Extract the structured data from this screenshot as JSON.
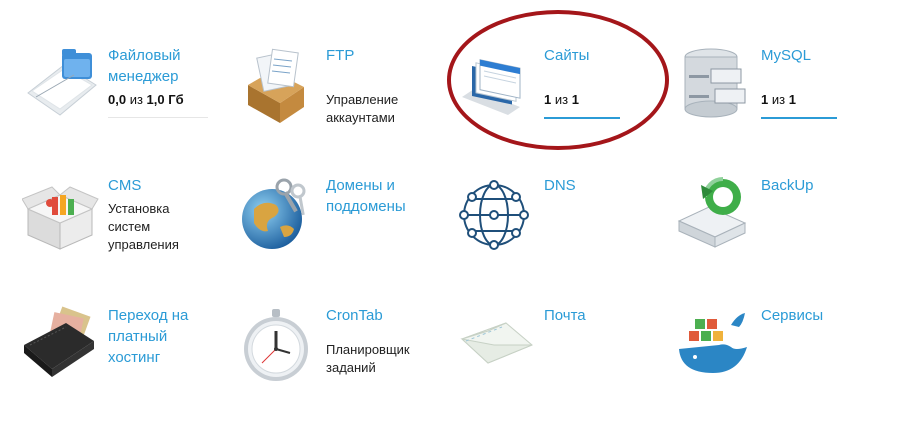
{
  "tiles": [
    {
      "id": "file-manager",
      "title": "Файловый\nменеджер",
      "usage_used": "0,0",
      "usage_sep": " из ",
      "usage_total": "1,0 Гб",
      "usage_fraction": 0.0,
      "icon": "folder-icon"
    },
    {
      "id": "ftp",
      "title": "FTP",
      "desc": "Управление\nаккаунтами",
      "icon": "ftp-box-icon"
    },
    {
      "id": "sites",
      "title": "Сайты",
      "usage_used": "1",
      "usage_sep": " из ",
      "usage_total": "1",
      "usage_fraction": 1.0,
      "icon": "sites-stack-icon"
    },
    {
      "id": "mysql",
      "title": "MySQL",
      "usage_used": "1",
      "usage_sep": " из ",
      "usage_total": "1",
      "usage_fraction": 1.0,
      "icon": "database-icon"
    },
    {
      "id": "cms",
      "title": "CMS",
      "desc": "Установка\nсистем\nуправления",
      "icon": "package-box-icon"
    },
    {
      "id": "domains",
      "title": "Домены и\nподдомены",
      "icon": "globe-keys-icon"
    },
    {
      "id": "dns",
      "title": "DNS",
      "icon": "network-icon"
    },
    {
      "id": "backup",
      "title": "BackUp",
      "icon": "backup-drive-icon"
    },
    {
      "id": "paid-hosting",
      "title": "Переход на\nплатный\nхостинг",
      "icon": "wallet-icon"
    },
    {
      "id": "crontab",
      "title": "CronTab",
      "desc": "Планировщик\nзаданий",
      "icon": "clock-icon"
    },
    {
      "id": "mail",
      "title": "Почта",
      "icon": "envelope-icon"
    },
    {
      "id": "services",
      "title": "Сервисы",
      "icon": "whale-containers-icon"
    }
  ],
  "colors": {
    "link": "#2b9bd6",
    "highlight": "#a4161a",
    "usage_fill": "#2b9bd6"
  }
}
